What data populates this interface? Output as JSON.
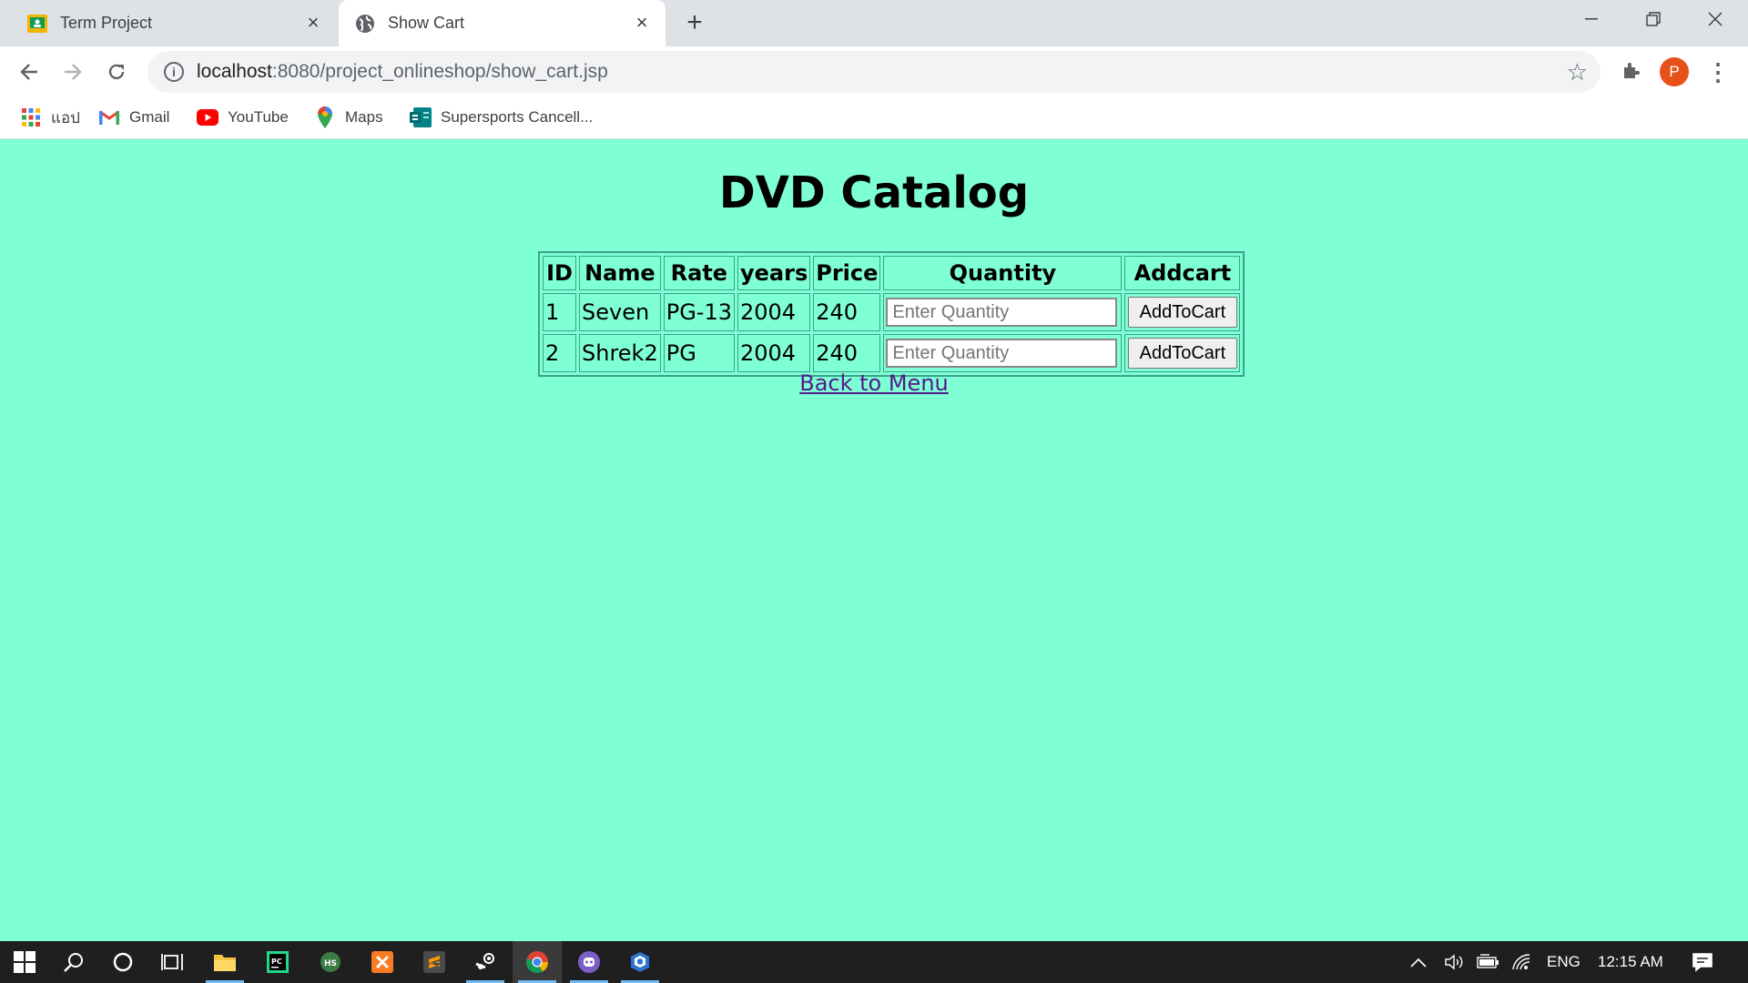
{
  "browser": {
    "tabs": [
      {
        "title": "Term Project",
        "active": false,
        "icon": "classroom-icon"
      },
      {
        "title": "Show Cart",
        "active": true,
        "icon": "globe-icon"
      }
    ],
    "url_host": "localhost",
    "url_path": ":8080/project_onlineshop/show_cart.jsp",
    "profile_initial": "P",
    "bookmarks": [
      {
        "label": "แอป",
        "icon": "apps-grid-icon"
      },
      {
        "label": "Gmail",
        "icon": "gmail-icon"
      },
      {
        "label": "YouTube",
        "icon": "youtube-icon"
      },
      {
        "label": "Maps",
        "icon": "maps-icon"
      },
      {
        "label": "Supersports Cancell...",
        "icon": "forms-icon"
      }
    ]
  },
  "page": {
    "title": "DVD Catalog",
    "table": {
      "headers": [
        "ID",
        "Name",
        "Rate",
        "years",
        "Price",
        "Quantity",
        "Addcart"
      ],
      "rows": [
        {
          "id": "1",
          "name": "Seven",
          "rate": "PG-13",
          "years": "2004",
          "price": "240"
        },
        {
          "id": "2",
          "name": "Shrek2",
          "rate": "PG",
          "years": "2004",
          "price": "240"
        }
      ],
      "quantity_placeholder": "Enter Quantity",
      "add_button_label": "AddToCart"
    },
    "back_link": "Back to Menu"
  },
  "taskbar": {
    "language": "ENG",
    "time": "12:15 AM"
  },
  "colors": {
    "page_background": "#7fffd4",
    "link_visited": "#551a8b",
    "profile_avatar": "#e8501a"
  }
}
